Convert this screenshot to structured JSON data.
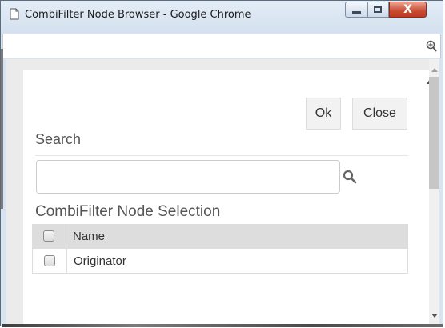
{
  "window": {
    "title": "CombiFilter Node Browser - Google Chrome",
    "close_glyph": "X",
    "colors": {
      "titlebar": "#d4e0ee",
      "close_button": "#c94a31",
      "header_row": "#dddddd"
    }
  },
  "toolbar": {
    "ok_label": "Ok",
    "close_label": "Close"
  },
  "search": {
    "label": "Search",
    "value": "",
    "placeholder": ""
  },
  "selection": {
    "label": "CombiFilter Node Selection",
    "columns": [
      "Name"
    ],
    "rows": [
      {
        "name": "Originator",
        "checked": false
      }
    ],
    "header_checked": false
  },
  "icons": {
    "title": "page-icon",
    "zoom": "zoom-icon",
    "search": "search-icon"
  }
}
